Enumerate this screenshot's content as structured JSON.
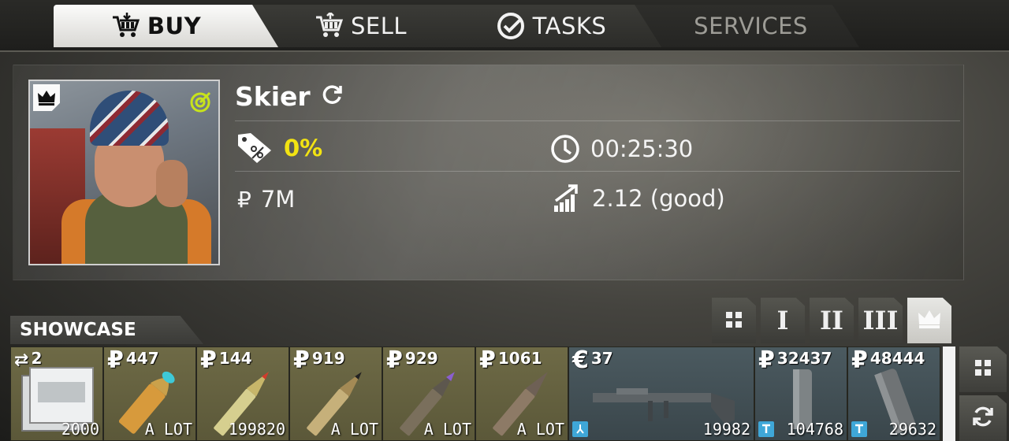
{
  "tabs": {
    "buy": "BUY",
    "sell": "SELL",
    "tasks": "TASKS",
    "services": "SERVICES"
  },
  "trader": {
    "name": "Skier",
    "discount": "0%",
    "timer": "00:25:30",
    "currency_symbol": "₽",
    "funds": "7M",
    "standing": "2.12 (good)"
  },
  "showcase": {
    "label": "SHOWCASE",
    "filters": [
      "",
      "I",
      "II",
      "III",
      ""
    ],
    "items": [
      {
        "currency": "⇄",
        "price": "2",
        "qty": "2000",
        "bg": "olive"
      },
      {
        "currency": "₽",
        "price": "447",
        "qty": "A LOT",
        "bg": "olive"
      },
      {
        "currency": "₽",
        "price": "144",
        "qty": "199820",
        "bg": "olive"
      },
      {
        "currency": "₽",
        "price": "919",
        "qty": "A LOT",
        "bg": "olive"
      },
      {
        "currency": "₽",
        "price": "929",
        "qty": "A LOT",
        "bg": "olive"
      },
      {
        "currency": "₽",
        "price": "1061",
        "qty": "A LOT",
        "bg": "olive"
      },
      {
        "currency": "€",
        "price": "37",
        "qty": "19982",
        "bg": "blue"
      },
      {
        "currency": "₽",
        "price": "32437",
        "qty": "104768",
        "bg": "blue"
      },
      {
        "currency": "₽",
        "price": "48444",
        "qty": "29632",
        "bg": "blue"
      }
    ]
  },
  "colors": {
    "accent_yellow": "#f2e312",
    "tab_active": "#eeeeec",
    "item_olive": "#6e6a46",
    "item_blue": "#4b5a60",
    "badge_blue": "#3fa7d8"
  }
}
